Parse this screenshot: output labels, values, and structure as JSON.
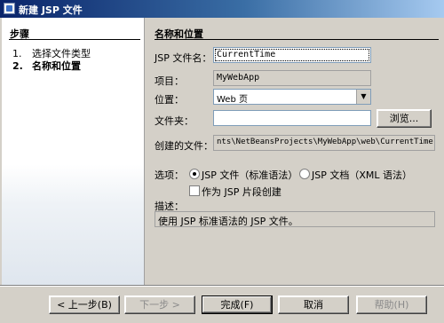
{
  "window": {
    "title": "新建 JSP 文件"
  },
  "steps": {
    "header": "步骤",
    "items": [
      {
        "num": "1.",
        "label": "选择文件类型"
      },
      {
        "num": "2.",
        "label": "名称和位置"
      }
    ]
  },
  "panel": {
    "title": "名称和位置",
    "filename_label": "JSP 文件名：",
    "filename_value": "CurrentTime",
    "project_label": "项目：",
    "project_value": "MyWebApp",
    "location_label": "位置：",
    "location_value": "Web 页",
    "folder_label": "文件夹：",
    "folder_value": "",
    "browse_label": "浏览...",
    "created_label": "创建的文件：",
    "created_value": "nts\\NetBeansProjects\\MyWebApp\\web\\CurrentTime.jsp",
    "options_label": "选项：",
    "radio_standard": "JSP 文件（标准语法）",
    "radio_xml": "JSP 文档（XML 语法）",
    "checkbox_segment": "作为 JSP 片段创建",
    "desc_label": "描述：",
    "desc_value": "使用 JSP 标准语法的 JSP 文件。"
  },
  "buttons": {
    "back": "< 上一步(B)",
    "next": "下一步 >",
    "finish": "完成(F)",
    "cancel": "取消",
    "help": "帮助(H)"
  }
}
